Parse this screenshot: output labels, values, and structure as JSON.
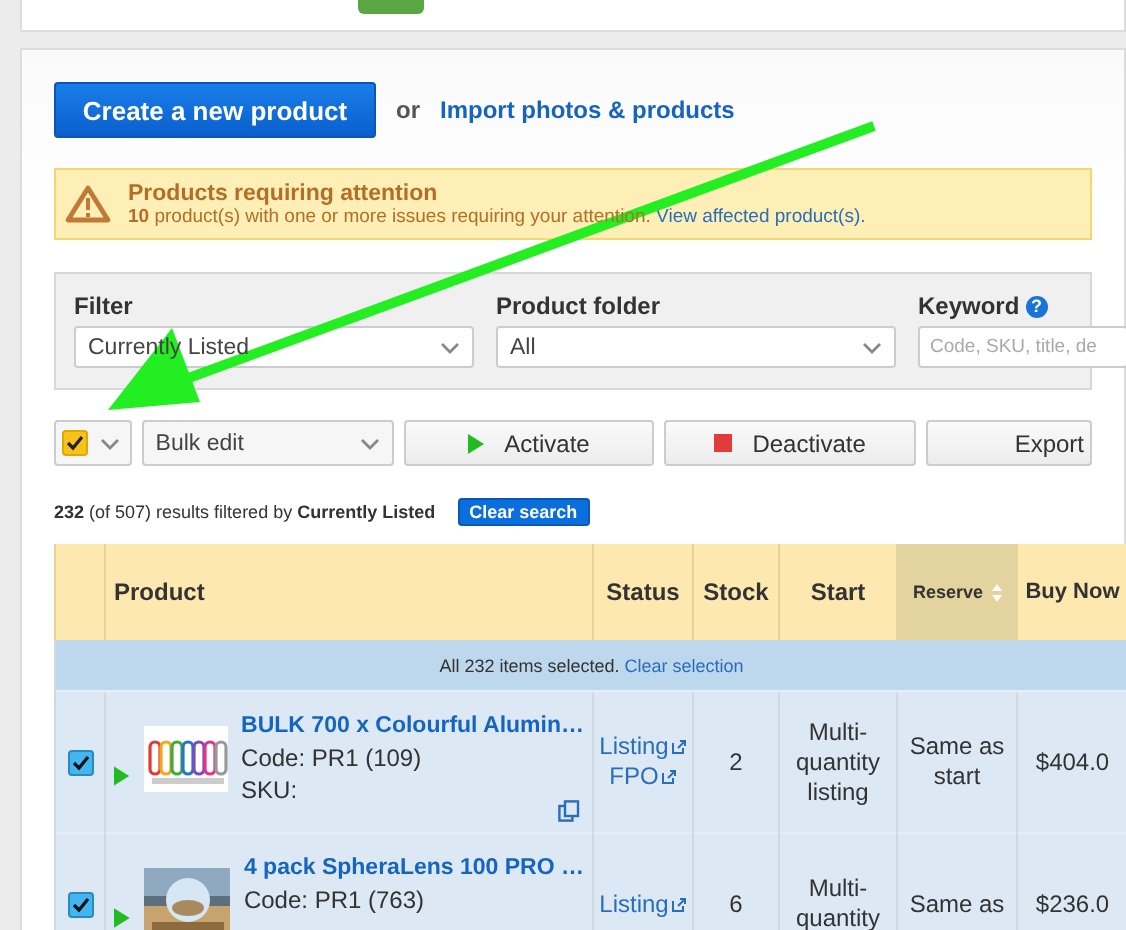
{
  "nav": {
    "kind": "tabs-cut-off"
  },
  "create_button": "Create a new product",
  "import_prefix": "or",
  "import_link": "Import photos & products",
  "alert": {
    "title": "Products requiring attention",
    "message": "**10** product(s) with one or more issues requiring your attention.",
    "link": "View affected product(s)."
  },
  "filters": [
    {
      "label": "Filter",
      "kind": "select",
      "value": "Currently Listed"
    },
    {
      "label": "Product folder",
      "kind": "select",
      "value": "All"
    },
    {
      "label": "Keyword",
      "kind": "text",
      "placeholder": "Code, SKU, title, de",
      "help": "?"
    }
  ],
  "toolbar": {
    "select_all_checked": true,
    "bulk_edit": "Bulk edit",
    "buttons": [
      {
        "label": "Activate",
        "kind": "activate"
      },
      {
        "label": "Deactivate",
        "kind": "deactivate"
      },
      {
        "label": "Export",
        "kind": "plain"
      }
    ]
  },
  "results": {
    "summary": "**232** (of 507) results filtered by **Currently Listed**",
    "clear": "Clear search"
  },
  "table": {
    "columns": [
      {
        "label": "Product",
        "sorted": false
      },
      {
        "label": "Status",
        "sorted": false
      },
      {
        "label": "Stock",
        "sorted": false
      },
      {
        "label": "Start",
        "sorted": false
      },
      {
        "label": "Reserve",
        "sorted": true
      },
      {
        "label": "Buy Now",
        "sorted": false
      }
    ],
    "selection_banner": {
      "text": "All 232 items selected.",
      "link": "Clear selection"
    },
    "rows": [
      {
        "checked": true,
        "active": true,
        "title": "BULK 700 x Colourful Alumin…",
        "code": "Code: PR1 (109)",
        "sku": "SKU:",
        "links": [
          "Listing",
          "FPO"
        ],
        "stock": "2",
        "start": "Multi-quantity listing",
        "reserve": "Same as start",
        "buy_now": "$404.0",
        "kind": "picture"
      },
      {
        "checked": true,
        "active": true,
        "title": "4 pack SpheraLens 100 PRO …",
        "code": "Code: PR1 (763)",
        "links": [
          "Listing"
        ],
        "stock": "6",
        "start": "Multi-quantity",
        "reserve": "Same as",
        "buy_now": "$236.0",
        "kind": "picture"
      }
    ]
  }
}
